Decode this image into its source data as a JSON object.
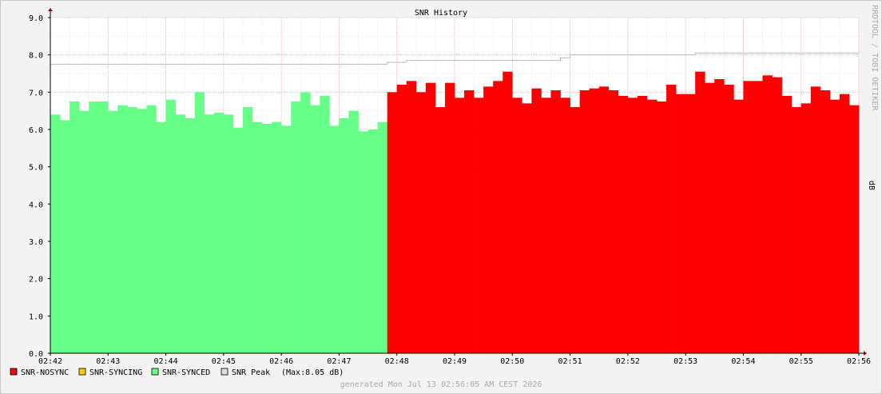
{
  "chart_data": {
    "type": "area",
    "title": "SNR History",
    "ylabel": "dB",
    "watermark": "RRDTOOL / TOBI OETIKER",
    "ylim": [
      0,
      9
    ],
    "y_ticks": [
      "0.0",
      "1.0",
      "2.0",
      "3.0",
      "4.0",
      "5.0",
      "6.0",
      "7.0",
      "8.0",
      "9.0"
    ],
    "x_ticks": [
      "02:42",
      "02:43",
      "02:44",
      "02:45",
      "02:46",
      "02:47",
      "02:48",
      "02:49",
      "02:50",
      "02:51",
      "02:52",
      "02:53",
      "02:54",
      "02:55",
      "02:56"
    ],
    "series": [
      {
        "name": "SNR-SYNCED",
        "color": "#66ff88",
        "x": [
          "02:42:00",
          "02:42:10",
          "02:42:20",
          "02:42:30",
          "02:42:40",
          "02:42:50",
          "02:43:00",
          "02:43:10",
          "02:43:20",
          "02:43:30",
          "02:43:40",
          "02:43:50",
          "02:44:00",
          "02:44:10",
          "02:44:20",
          "02:44:30",
          "02:44:40",
          "02:44:50",
          "02:45:00",
          "02:45:10",
          "02:45:20",
          "02:45:30",
          "02:45:40",
          "02:45:50",
          "02:46:00",
          "02:46:10",
          "02:46:20",
          "02:46:30",
          "02:46:40",
          "02:46:50",
          "02:47:00",
          "02:47:10",
          "02:47:20",
          "02:47:30",
          "02:47:40",
          "02:47:50"
        ],
        "values": [
          6.4,
          6.25,
          6.75,
          6.5,
          6.75,
          6.75,
          6.5,
          6.65,
          6.6,
          6.55,
          6.65,
          6.2,
          6.8,
          6.4,
          6.3,
          7.0,
          6.4,
          6.45,
          6.4,
          6.05,
          6.6,
          6.2,
          6.15,
          6.2,
          6.1,
          6.75,
          7.0,
          6.65,
          6.9,
          6.1,
          6.3,
          6.5,
          5.95,
          6.0,
          6.2,
          6.2
        ]
      },
      {
        "name": "SNR-NOSYNC",
        "color": "#ff0000",
        "x": [
          "02:47:50",
          "02:48:00",
          "02:48:10",
          "02:48:20",
          "02:48:30",
          "02:48:40",
          "02:48:50",
          "02:49:00",
          "02:49:10",
          "02:49:20",
          "02:49:30",
          "02:49:40",
          "02:49:50",
          "02:50:00",
          "02:50:10",
          "02:50:20",
          "02:50:30",
          "02:50:40",
          "02:50:50",
          "02:51:00",
          "02:51:10",
          "02:51:20",
          "02:51:30",
          "02:51:40",
          "02:51:50",
          "02:52:00",
          "02:52:10",
          "02:52:20",
          "02:52:30",
          "02:52:40",
          "02:52:50",
          "02:53:00",
          "02:53:10",
          "02:53:20",
          "02:53:30",
          "02:53:40",
          "02:53:50",
          "02:54:00",
          "02:54:10",
          "02:54:20",
          "02:54:30",
          "02:54:40",
          "02:54:50",
          "02:55:00",
          "02:55:10",
          "02:55:20",
          "02:55:30",
          "02:55:40",
          "02:55:50"
        ],
        "values": [
          7.0,
          7.2,
          7.3,
          7.0,
          7.25,
          6.6,
          7.25,
          6.85,
          7.05,
          6.85,
          7.15,
          7.3,
          7.55,
          6.85,
          6.7,
          7.1,
          6.85,
          7.05,
          6.85,
          6.6,
          7.05,
          7.1,
          7.15,
          7.05,
          6.9,
          6.85,
          6.9,
          6.8,
          6.75,
          7.2,
          6.95,
          6.95,
          7.55,
          7.25,
          7.35,
          7.2,
          6.8,
          7.3,
          7.3,
          7.45,
          7.4,
          6.9,
          6.6,
          6.7,
          7.15,
          7.05,
          6.8,
          6.95,
          6.65
        ]
      },
      {
        "name": "SNR Peak",
        "color": "#bbbbbb",
        "x": [
          "02:42:00",
          "02:47:30",
          "02:47:50",
          "02:48:10",
          "02:50:50",
          "02:51:00",
          "02:52:50",
          "02:53:10",
          "02:55:50"
        ],
        "values": [
          7.75,
          7.75,
          7.8,
          7.85,
          7.92,
          8.0,
          8.0,
          8.05,
          8.05
        ]
      }
    ],
    "legend": [
      {
        "name": "SNR-NOSYNC",
        "color": "#ff0000"
      },
      {
        "name": "SNR-SYNCING",
        "color": "#ffcc00"
      },
      {
        "name": "SNR-SYNCED",
        "color": "#66ff88"
      },
      {
        "name": "SNR Peak",
        "color": "#dddddd",
        "note": "(Max:8.05 dB)"
      }
    ],
    "legend_placement": "bottom-left",
    "grid": true
  },
  "footer": "generated Mon Jul 13 02:56:05 AM CEST 2026"
}
